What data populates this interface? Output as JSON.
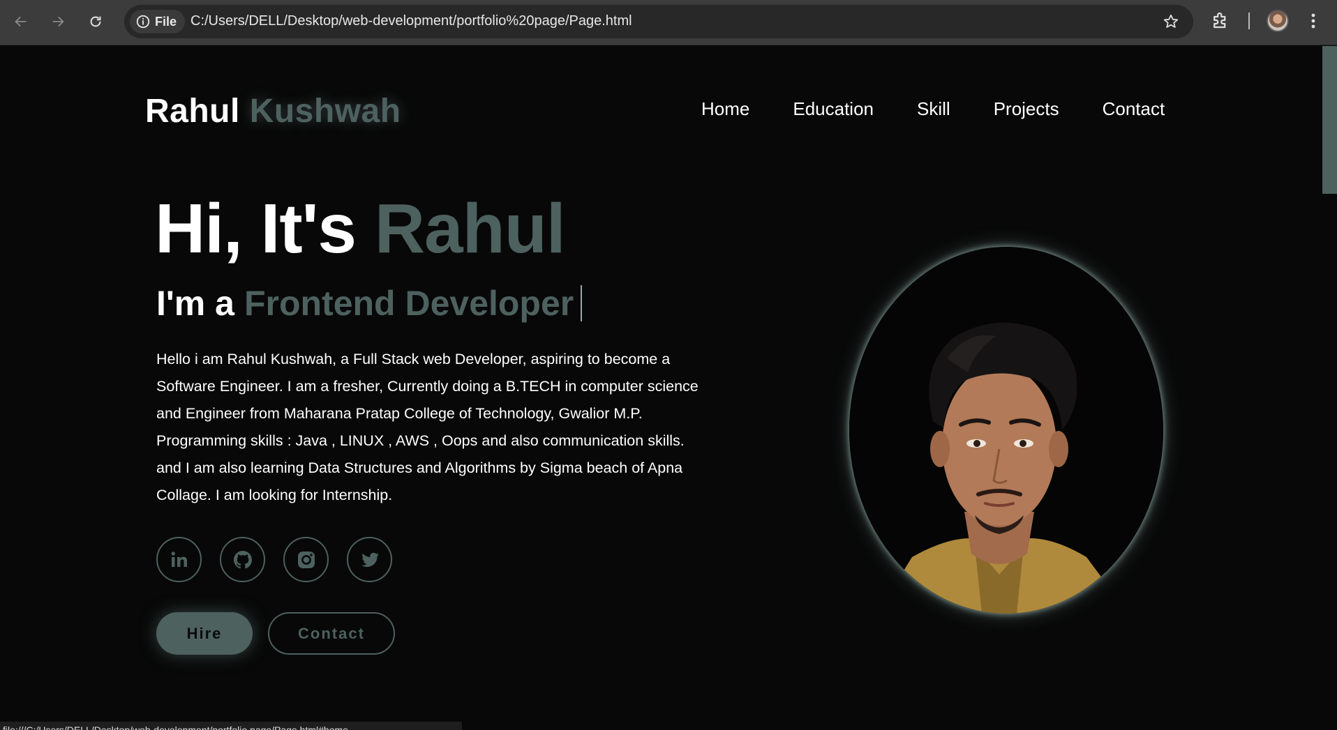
{
  "browser": {
    "site_chip_label": "File",
    "url": "C:/Users/DELL/Desktop/web-development/portfolio%20page/Page.html",
    "status_url": "file:///C:/Users/DELL/Desktop/web-development/portfolio page/Page.html#home"
  },
  "header": {
    "logo_first": "Rahul",
    "logo_last": "Kushwah",
    "nav": [
      "Home",
      "Education",
      "Skill",
      "Projects",
      "Contact"
    ]
  },
  "hero": {
    "greeting": "Hi, It's",
    "name": "Rahul",
    "role_prefix": "I'm a",
    "role": "Frontend Developer",
    "bio": "Hello i am Rahul Kushwah, a Full Stack web Developer, aspiring to become a Software Engineer. I am a fresher, Currently doing a B.TECH in computer science and Engineer from Maharana Pratap College of Technology, Gwalior M.P. Programming skills : Java , LINUX , AWS , Oops and also communication skills. and I am also learning Data Structures and Algorithms by Sigma beach of Apna Collage. I am looking for Internship.",
    "socials": [
      "linkedin-icon",
      "github-icon",
      "instagram-icon",
      "twitter-icon"
    ],
    "hire_label": "Hire",
    "contact_label": "Contact"
  },
  "colors": {
    "accent": "#4d615f",
    "background": "#080808",
    "text": "#ffffff"
  }
}
